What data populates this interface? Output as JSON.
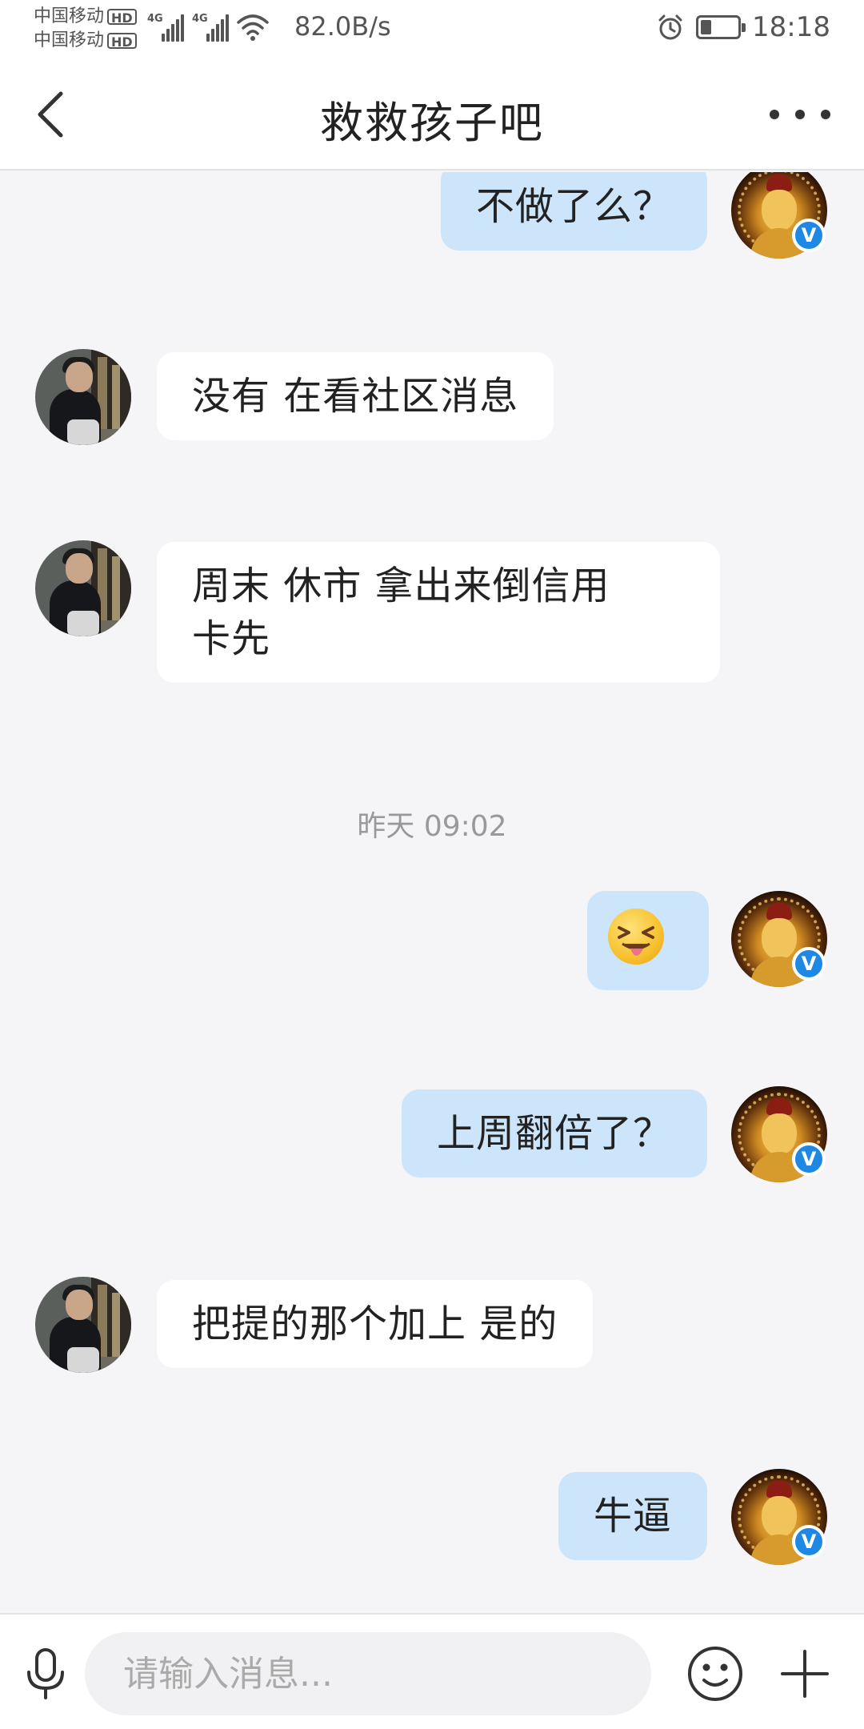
{
  "status_bar": {
    "carrier_1": "中国移动",
    "carrier_2": "中国移动",
    "hd_label": "HD",
    "network_type": "4G",
    "net_speed": "82.0B/s",
    "time": "18:18",
    "battery_level": 0.3,
    "icons": [
      "alarm-icon",
      "battery-icon",
      "wifi-icon",
      "signal-icon"
    ]
  },
  "nav": {
    "back_icon": "chevron-left-icon",
    "title": "救救孩子吧",
    "more_icon": "more-dots-icon"
  },
  "messages": [
    {
      "sender": "self",
      "text": "不做了么？"
    },
    {
      "sender": "other",
      "text": "没有 在看社区消息"
    },
    {
      "sender": "other",
      "text": "周末 休市 拿出来倒信用\n卡先"
    },
    {
      "timestamp": "昨天 09:02"
    },
    {
      "sender": "self",
      "emoji": "squinting-face-with-tongue"
    },
    {
      "sender": "self",
      "text": "上周翻倍了？"
    },
    {
      "sender": "other",
      "text": "把提的那个加上 是的"
    },
    {
      "sender": "self",
      "text": "牛逼"
    }
  ],
  "verified_badge": "V",
  "input": {
    "placeholder": "请输入消息..."
  },
  "colors": {
    "self_bubble": "#cde5fb",
    "other_bubble": "#ffffff",
    "background": "#f5f5f7",
    "verified": "#1e88e5"
  }
}
